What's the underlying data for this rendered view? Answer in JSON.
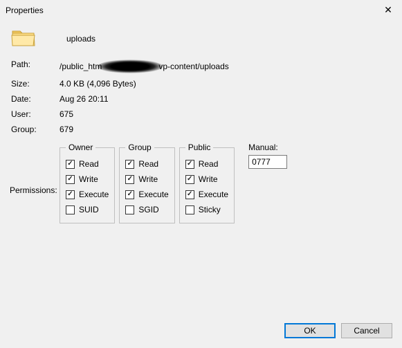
{
  "window": {
    "title": "Properties",
    "close_glyph": "✕"
  },
  "folder": {
    "name": "uploads"
  },
  "info": {
    "path_label": "Path:",
    "path_pre": "/public_htm",
    "path_post": "vp-content/uploads",
    "size_label": "Size:",
    "size_value": "4.0 KB  (4,096 Bytes)",
    "date_label": "Date:",
    "date_value": "Aug 26 20:11",
    "user_label": "User:",
    "user_value": "675",
    "group_label": "Group:",
    "group_value": "679"
  },
  "permissions": {
    "label": "Permissions:",
    "owner": {
      "legend": "Owner",
      "read_label": "Read",
      "read": true,
      "write_label": "Write",
      "write": true,
      "execute_label": "Execute",
      "execute": true,
      "special_label": "SUID",
      "special": false
    },
    "group": {
      "legend": "Group",
      "read_label": "Read",
      "read": true,
      "write_label": "Write",
      "write": true,
      "execute_label": "Execute",
      "execute": true,
      "special_label": "SGID",
      "special": false
    },
    "public": {
      "legend": "Public",
      "read_label": "Read",
      "read": true,
      "write_label": "Write",
      "write": true,
      "execute_label": "Execute",
      "execute": true,
      "special_label": "Sticky",
      "special": false
    },
    "manual_label": "Manual:",
    "manual_value": "0777"
  },
  "buttons": {
    "ok": "OK",
    "cancel": "Cancel"
  }
}
